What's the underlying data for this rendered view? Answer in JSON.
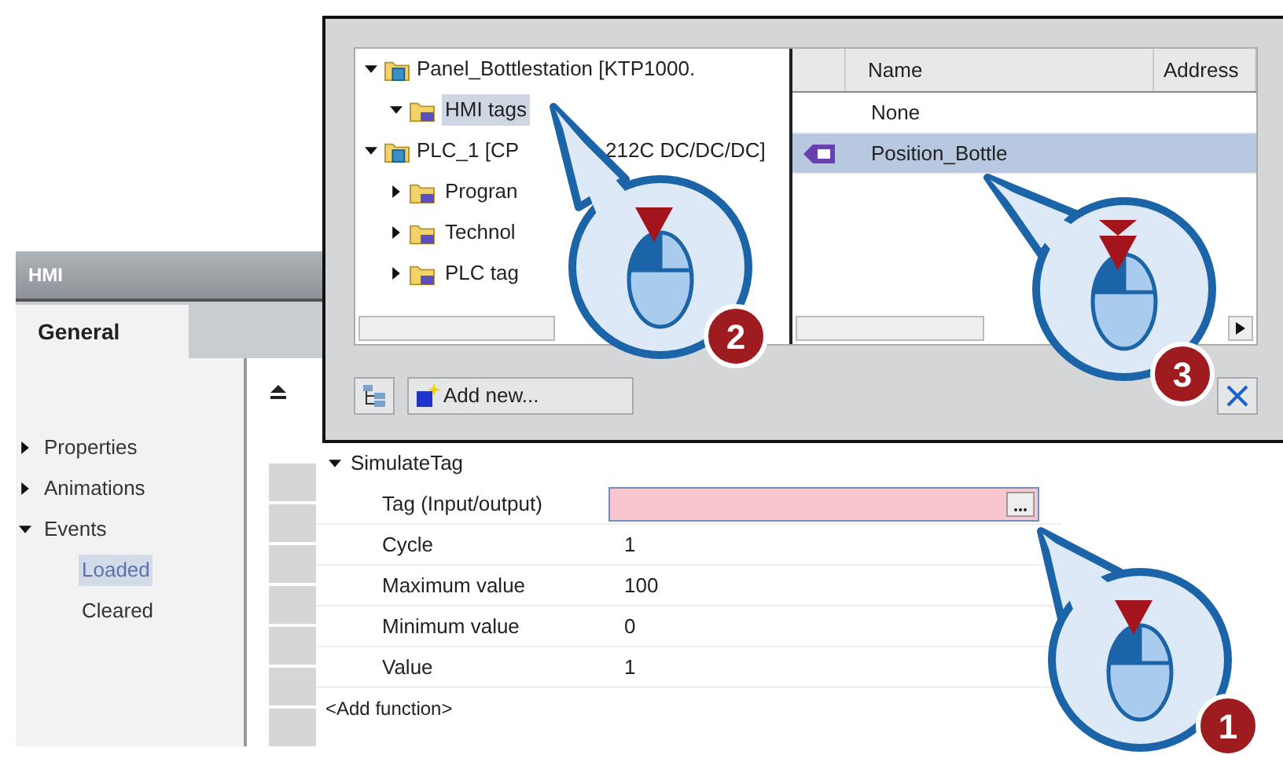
{
  "properties_panel": {
    "title": "HMI",
    "tabs": [
      {
        "label": "General",
        "selected": true
      }
    ],
    "nav": [
      {
        "label": "Properties",
        "expanded": false
      },
      {
        "label": "Animations",
        "expanded": false
      },
      {
        "label": "Events",
        "expanded": true,
        "children": [
          {
            "label": "Loaded",
            "selected": true
          },
          {
            "label": "Cleared",
            "selected": false
          }
        ]
      }
    ],
    "function": {
      "name": "SimulateTag",
      "expanded": true,
      "params": [
        {
          "label": "Tag (Input/output)",
          "kind": "picker",
          "highlighted": true
        },
        {
          "label": "Cycle",
          "kind": "text",
          "value": "1"
        },
        {
          "label": "Maximum value",
          "kind": "text",
          "value": "100"
        },
        {
          "label": "Minimum value",
          "kind": "text",
          "value": "0"
        },
        {
          "label": "Value",
          "kind": "text",
          "value": "1"
        }
      ],
      "add": "<Add function>"
    }
  },
  "tag_dialog": {
    "tree": [
      {
        "label": "Panel_Bottlestation [KTP1000.",
        "kind": "device",
        "expanded": true,
        "children": [
          {
            "label": "HMI tags",
            "kind": "folder",
            "expanded": true,
            "selected": true
          }
        ]
      },
      {
        "label": "PLC_1 [CP",
        "label_end": "212C DC/DC/DC]",
        "kind": "device",
        "expanded": true,
        "children": [
          {
            "label": "Progran",
            "kind": "folder",
            "expanded": false
          },
          {
            "label": "Technol",
            "kind": "folder",
            "expanded": false
          },
          {
            "label": "PLC tag",
            "kind": "folder",
            "expanded": false
          }
        ]
      }
    ],
    "columns": [
      "Name",
      "Address"
    ],
    "rows": [
      {
        "name": "None",
        "selected": false,
        "tag_icon": false
      },
      {
        "name": "Position_Bottle",
        "selected": true,
        "tag_icon": true
      }
    ],
    "add_button": "Add new..."
  },
  "callouts": [
    {
      "number": "1",
      "kind": "click"
    },
    {
      "number": "2",
      "kind": "click"
    },
    {
      "number": "3",
      "kind": "double_click"
    }
  ]
}
